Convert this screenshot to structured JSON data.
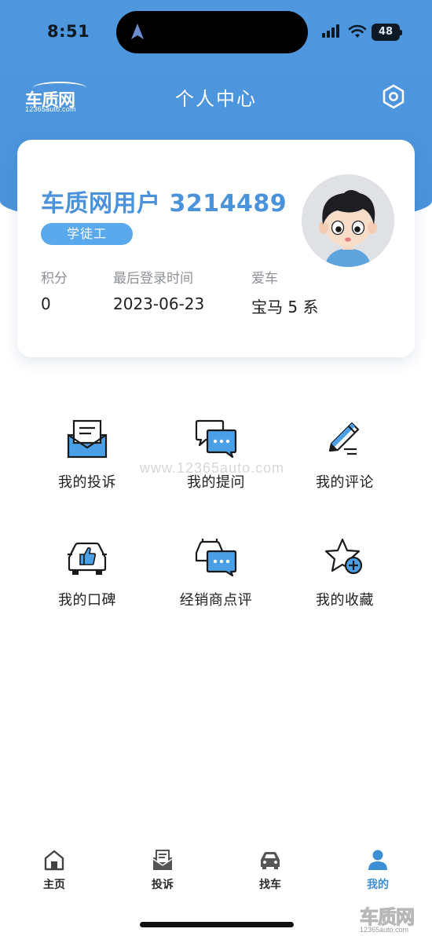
{
  "status_bar": {
    "time": "8:51",
    "battery": "48"
  },
  "header": {
    "logo_text": "车质网",
    "logo_sub": "12365auto.com",
    "title": "个人中心"
  },
  "profile": {
    "username": "车质网用户 3214489",
    "level_badge": "学徒工",
    "stats": {
      "points_label": "积分",
      "points_value": "0",
      "last_login_label": "最后登录时间",
      "last_login_value": "2023-06-23",
      "car_label": "爱车",
      "car_value": "宝马 5 系"
    }
  },
  "watermark": "www.12365auto.com",
  "menu": [
    {
      "label": "我的投诉",
      "icon": "envelope-icon"
    },
    {
      "label": "我的提问",
      "icon": "chat-bubbles-icon"
    },
    {
      "label": "我的评论",
      "icon": "pen-icon"
    },
    {
      "label": "我的口碑",
      "icon": "car-thumbs-up-icon"
    },
    {
      "label": "经销商点评",
      "icon": "dealer-chat-icon"
    },
    {
      "label": "我的收藏",
      "icon": "star-plus-icon"
    }
  ],
  "tabbar": [
    {
      "label": "主页",
      "icon": "home-icon",
      "active": false
    },
    {
      "label": "投诉",
      "icon": "complaint-icon",
      "active": false
    },
    {
      "label": "找车",
      "icon": "car-icon",
      "active": false
    },
    {
      "label": "我的",
      "icon": "person-icon",
      "active": true
    }
  ],
  "corner_mark": {
    "main": "车质网",
    "sub": "12365auto.com"
  },
  "colors": {
    "primary": "#4a93db",
    "badge": "#59a9ec",
    "icon_fill": "#4a9fe6"
  }
}
